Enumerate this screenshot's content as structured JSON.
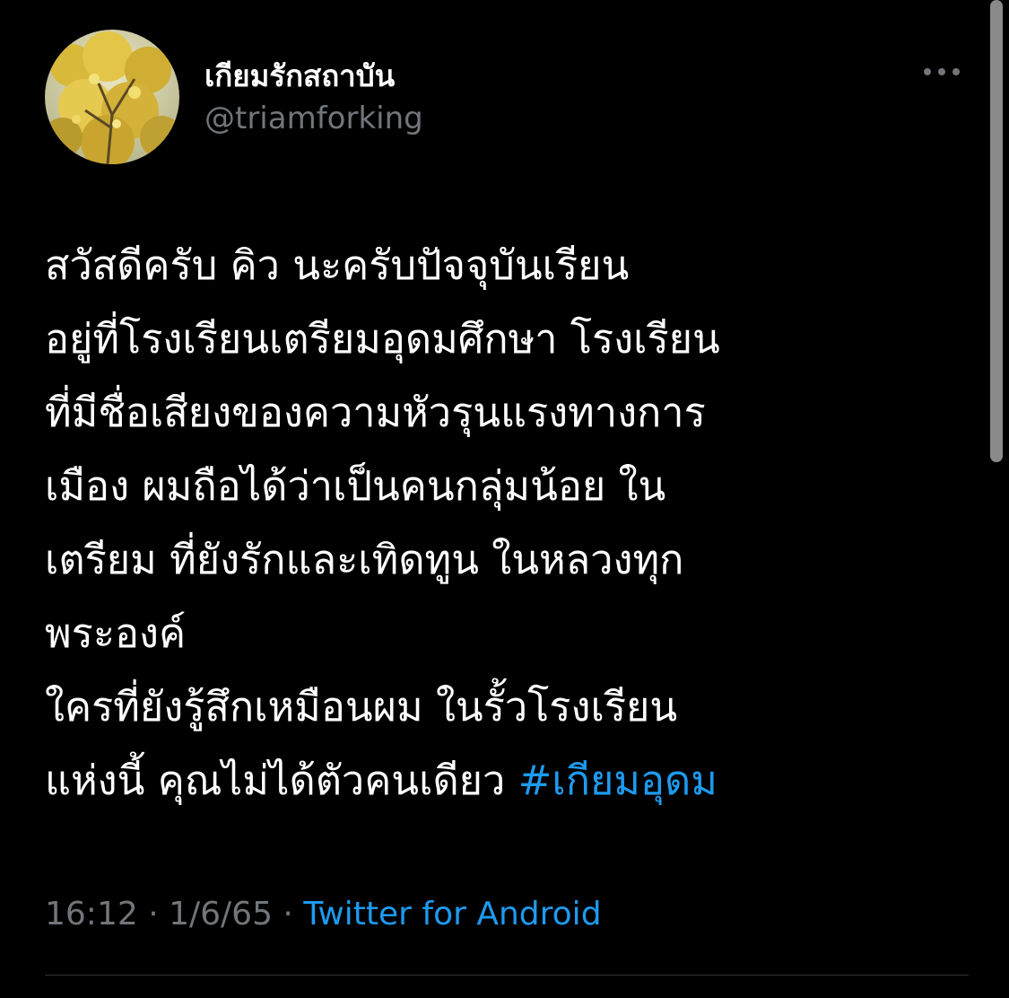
{
  "author": {
    "display_name": "เกียมรักสถาบัน",
    "handle": "@triamforking"
  },
  "tweet": {
    "lines": [
      "สวัสดีครับ คิว นะครับปัจจุบันเรียน",
      "อยู่ที่โรงเรียนเตรียมอุดมศึกษา โรงเรียน",
      "ที่มีชื่อเสียงของความหัวรุนแรงทางการ",
      "เมือง ผมถือได้ว่าเป็นคนกลุ่มน้อย ใน",
      "เตรียม ที่ยังรักและเทิดทูน  ในหลวงทุก",
      "พระองค์",
      "ใครที่ยังรู้สึกเหมือนผม  ในรั้วโรงเรียน"
    ],
    "last_line": "แห่งนี้ คุณไม่ได้ตัวคนเดียว ",
    "hashtag": "#เกียมอุดม"
  },
  "meta": {
    "time": "16:12",
    "separator": " · ",
    "date": "1/6/65",
    "source": "Twitter for Android"
  },
  "icons": {
    "avatar": "yellow-tree-avatar-icon",
    "more": "more-dots-icon"
  },
  "colors": {
    "background": "#000000",
    "text": "#ffffff",
    "secondary": "#71767b",
    "link": "#1d9bf0"
  }
}
